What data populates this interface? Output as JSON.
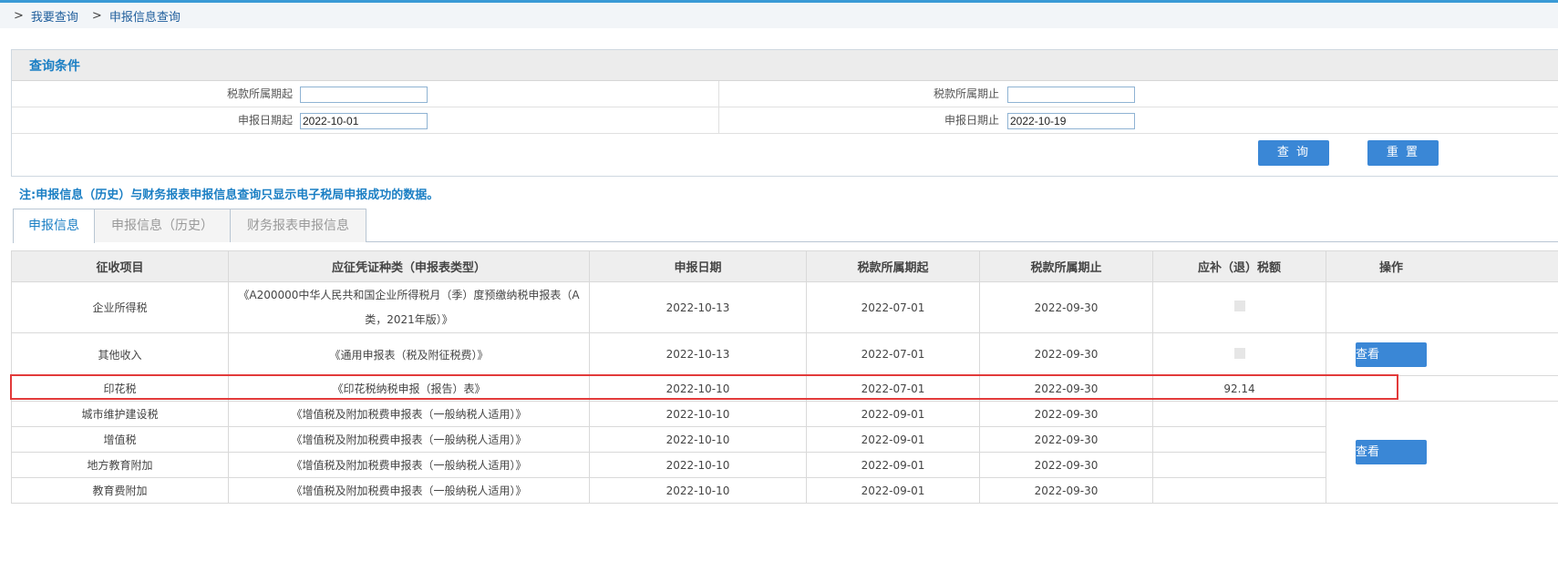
{
  "breadcrumb": {
    "sep": ">",
    "items": [
      "我要查询",
      "申报信息查询"
    ]
  },
  "query": {
    "title": "查询条件",
    "fields": {
      "tax_period_start": {
        "label": "税款所属期起",
        "value": ""
      },
      "tax_period_end": {
        "label": "税款所属期止",
        "value": ""
      },
      "declare_date_start": {
        "label": "申报日期起",
        "value": "2022-10-01"
      },
      "declare_date_end": {
        "label": "申报日期止",
        "value": "2022-10-19"
      }
    },
    "buttons": {
      "search": "查 询",
      "reset": "重 置"
    }
  },
  "note": "注:申报信息（历史）与财务报表申报信息查询只显示电子税局申报成功的数据。",
  "tabs": [
    "申报信息",
    "申报信息（历史）",
    "财务报表申报信息"
  ],
  "table": {
    "headers": [
      "征收项目",
      "应征凭证种类（申报表类型）",
      "申报日期",
      "税款所属期起",
      "税款所属期止",
      "应补（退）税额",
      "操作"
    ],
    "rows": [
      {
        "item": "企业所得税",
        "type": "《A200000中华人民共和国企业所得税月（季）度预缴纳税申报表（A类，2021年版）》",
        "date": "2022-10-13",
        "start": "2022-07-01",
        "end": "2022-09-30",
        "amount": ""
      },
      {
        "item": "其他收入",
        "type": "《通用申报表（税及附征税费）》",
        "date": "2022-10-13",
        "start": "2022-07-01",
        "end": "2022-09-30",
        "amount": ""
      },
      {
        "item": "印花税",
        "type": "《印花税纳税申报（报告）表》",
        "date": "2022-10-10",
        "start": "2022-07-01",
        "end": "2022-09-30",
        "amount": "92.14"
      },
      {
        "item": "城市维护建设税",
        "type": "《增值税及附加税费申报表（一般纳税人适用）》",
        "date": "2022-10-10",
        "start": "2022-09-01",
        "end": "2022-09-30",
        "amount": ""
      },
      {
        "item": "增值税",
        "type": "《增值税及附加税费申报表（一般纳税人适用）》",
        "date": "2022-10-10",
        "start": "2022-09-01",
        "end": "2022-09-30",
        "amount": ""
      },
      {
        "item": "地方教育附加",
        "type": "《增值税及附加税费申报表（一般纳税人适用）》",
        "date": "2022-10-10",
        "start": "2022-09-01",
        "end": "2022-09-30",
        "amount": ""
      },
      {
        "item": "教育费附加",
        "type": "《增值税及附加税费申报表（一般纳税人适用）》",
        "date": "2022-10-10",
        "start": "2022-09-01",
        "end": "2022-09-30",
        "amount": ""
      }
    ],
    "view_label": "查看"
  },
  "colors": {
    "accent": "#3a87d6",
    "title_blue": "#1b7fc4",
    "highlight": "#e23a3a"
  }
}
